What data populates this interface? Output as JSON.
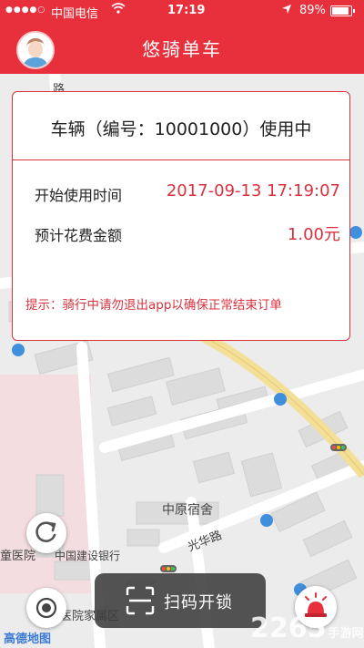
{
  "status_bar": {
    "signal_dots": "●●●●○",
    "carrier": "中国电信",
    "time": "17:19",
    "battery_pct": "89%"
  },
  "header": {
    "title": "悠骑单车"
  },
  "order_card": {
    "title": "车辆（编号：10001000）使用中",
    "start_time_label": "开始使用时间",
    "start_time_value": "2017-09-13 17:19:07",
    "estimate_label": "预计花费金额",
    "estimate_value": "1.00元",
    "tip": "提示：骑行中请勿退出app以确保正常结束订单"
  },
  "map": {
    "labels": {
      "zhongyuan_dorm": "中原宿舍",
      "guanghua_road": "光华路",
      "ccb_bank": "中国建设银行",
      "hospital": "童医院",
      "hospital_family_area": "医院家属区",
      "road_fragment": "路"
    },
    "logo": "高德地图"
  },
  "controls": {
    "scan_unlock_label": "扫码开锁"
  },
  "watermark": {
    "number": "2265",
    "suffix": "手游网"
  },
  "colors": {
    "brand_red": "#e8303c",
    "accent_red": "#d7323d"
  }
}
